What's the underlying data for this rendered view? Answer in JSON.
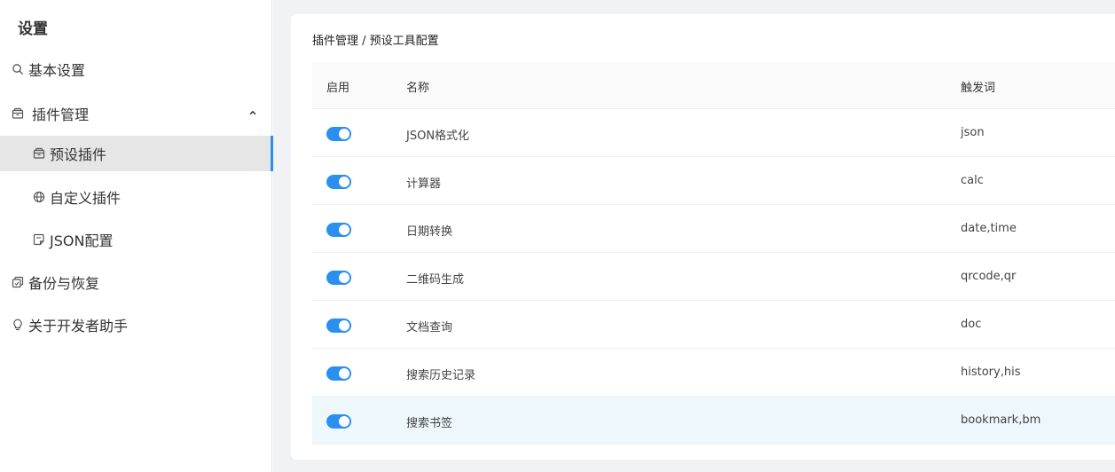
{
  "sidebar": {
    "title": "设置",
    "items": {
      "basic": {
        "label": "基本设置",
        "icon": "search-icon"
      },
      "plugin": {
        "label": "插件管理",
        "icon": "box-icon",
        "expanded": true
      },
      "preset": {
        "label": "预设插件",
        "icon": "box-icon",
        "active": true
      },
      "custom": {
        "label": "自定义插件",
        "icon": "globe-icon"
      },
      "json": {
        "label": "JSON配置",
        "icon": "note-icon"
      },
      "backup": {
        "label": "备份与恢复",
        "icon": "backup-icon"
      },
      "about": {
        "label": "关于开发者助手",
        "icon": "bulb-icon"
      }
    }
  },
  "main": {
    "breadcrumb": "插件管理 / 预设工具配置",
    "headers": {
      "enabled": "启用",
      "name": "名称",
      "trigger": "触发词"
    },
    "rows": [
      {
        "enabled": true,
        "name": "JSON格式化",
        "trigger": "json"
      },
      {
        "enabled": true,
        "name": "计算器",
        "trigger": "calc"
      },
      {
        "enabled": true,
        "name": "日期转换",
        "trigger": "date,time"
      },
      {
        "enabled": true,
        "name": "二维码生成",
        "trigger": "qrcode,qr"
      },
      {
        "enabled": true,
        "name": "文档查询",
        "trigger": "doc"
      },
      {
        "enabled": true,
        "name": "搜索历史记录",
        "trigger": "history,his"
      },
      {
        "enabled": true,
        "name": "搜索书签",
        "trigger": "bookmark,bm"
      }
    ]
  },
  "colors": {
    "accent": "#2b8ff0",
    "activeBg": "#e6e6e6",
    "rowHighlight": "#eef7fc",
    "mainBg": "#f0f2f5"
  }
}
